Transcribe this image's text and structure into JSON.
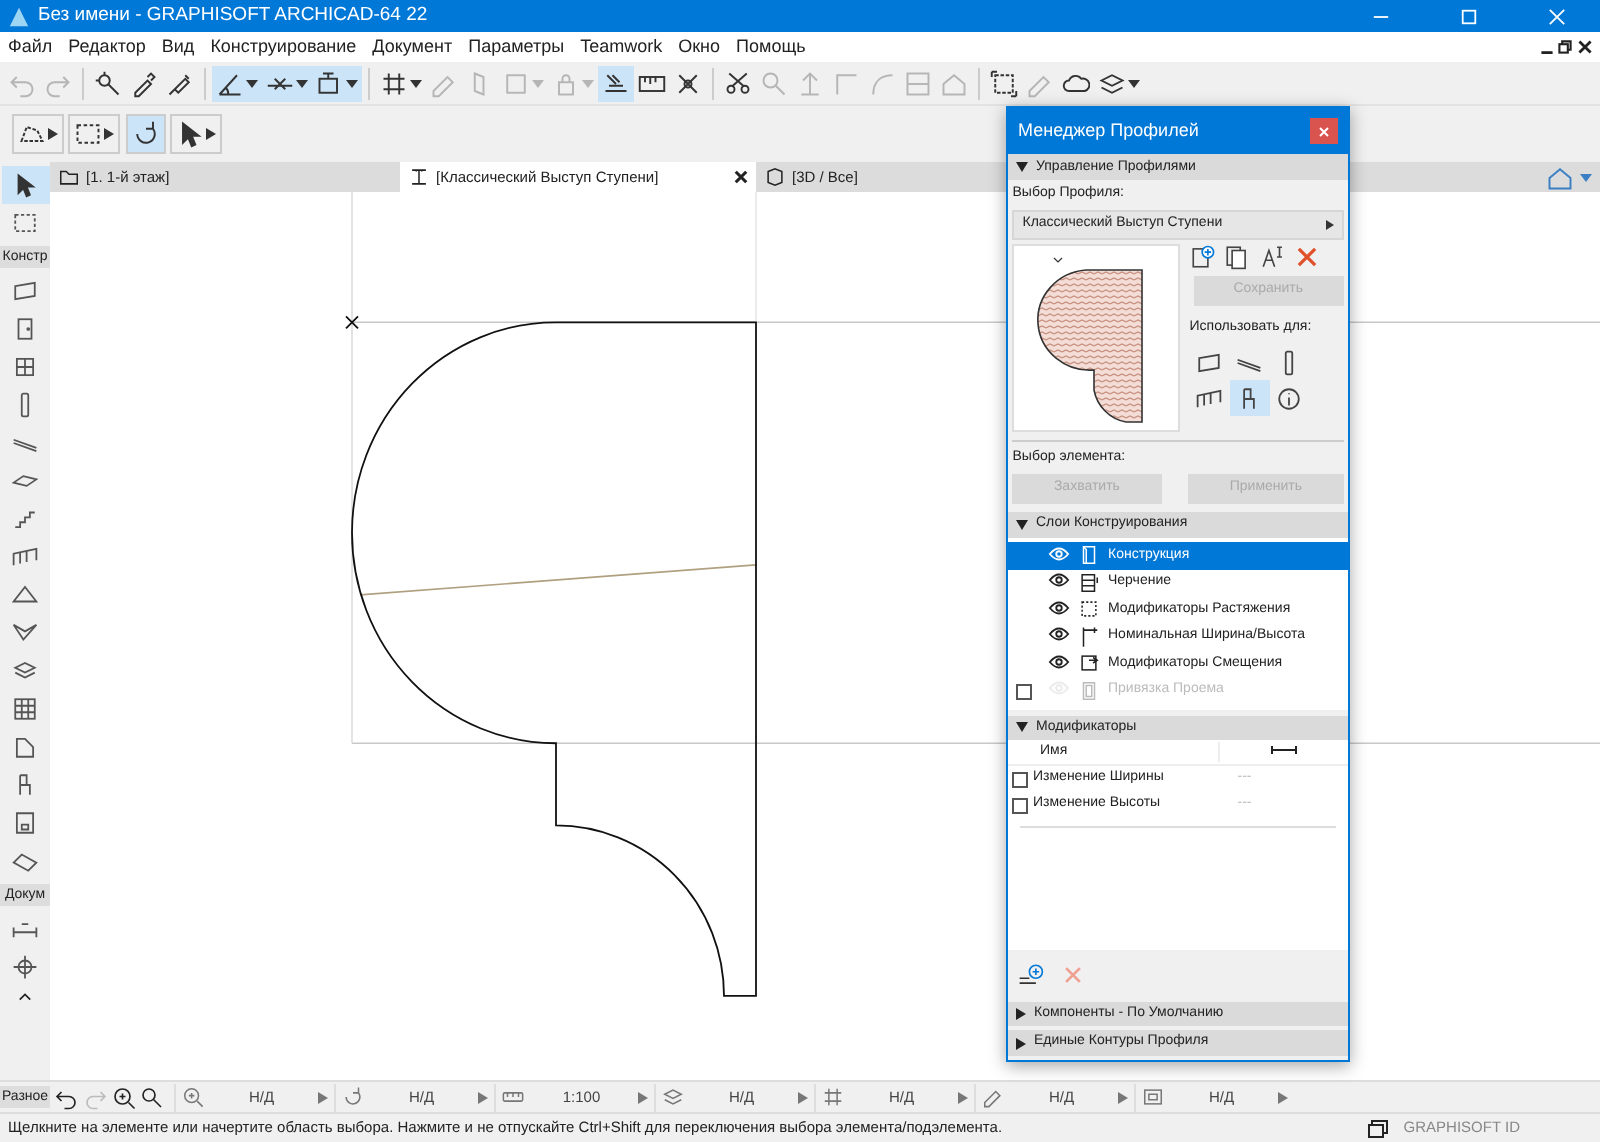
{
  "window": {
    "title": "Без имени - GRAPHISOFT ARCHICAD-64 22"
  },
  "menu": [
    "Файл",
    "Редактор",
    "Вид",
    "Конструирование",
    "Документ",
    "Параметры",
    "Teamwork",
    "Окно",
    "Помощь"
  ],
  "toolbar": [
    [
      {
        "kind": "undo",
        "on": false,
        "disabled": true,
        "dropdown": false
      },
      {
        "kind": "redo",
        "on": false,
        "disabled": true,
        "dropdown": false
      }
    ],
    [
      {
        "kind": "wand",
        "on": false,
        "disabled": false,
        "dropdown": false
      },
      {
        "kind": "eyedropper",
        "on": false,
        "disabled": false,
        "dropdown": false
      },
      {
        "kind": "syringe",
        "on": false,
        "disabled": false,
        "dropdown": false
      }
    ],
    [
      {
        "kind": "angle",
        "on": true,
        "disabled": false,
        "dropdown": true
      },
      {
        "kind": "snapline",
        "on": true,
        "disabled": false,
        "dropdown": true
      },
      {
        "kind": "boxsnap",
        "on": true,
        "disabled": false,
        "dropdown": true
      }
    ],
    [
      {
        "kind": "grid",
        "on": false,
        "disabled": false,
        "dropdown": true
      },
      {
        "kind": "pen",
        "on": false,
        "disabled": true,
        "dropdown": false
      },
      {
        "kind": "skew",
        "on": false,
        "disabled": true,
        "dropdown": false
      },
      {
        "kind": "square",
        "on": false,
        "disabled": true,
        "dropdown": true
      },
      {
        "kind": "lock",
        "on": false,
        "disabled": true,
        "dropdown": true
      },
      {
        "kind": "cursorgrid",
        "on": true,
        "disabled": false,
        "dropdown": false
      },
      {
        "kind": "ruler",
        "on": false,
        "disabled": false,
        "dropdown": false
      },
      {
        "kind": "cross",
        "on": false,
        "disabled": false,
        "dropdown": false
      }
    ],
    [
      {
        "kind": "scissors",
        "on": false,
        "disabled": false,
        "dropdown": false
      },
      {
        "kind": "magnifier",
        "on": false,
        "disabled": true,
        "dropdown": false
      },
      {
        "kind": "up",
        "on": false,
        "disabled": true,
        "dropdown": false
      },
      {
        "kind": "corner",
        "on": false,
        "disabled": true,
        "dropdown": false
      },
      {
        "kind": "curve",
        "on": false,
        "disabled": true,
        "dropdown": false
      },
      {
        "kind": "split",
        "on": false,
        "disabled": true,
        "dropdown": false
      },
      {
        "kind": "house",
        "on": false,
        "disabled": true,
        "dropdown": false
      }
    ],
    [
      {
        "kind": "selectframe",
        "on": false,
        "disabled": false,
        "dropdown": false
      },
      {
        "kind": "pen",
        "on": false,
        "disabled": true,
        "dropdown": false
      },
      {
        "kind": "cloud",
        "on": false,
        "disabled": false,
        "dropdown": false
      },
      {
        "kind": "layers",
        "on": false,
        "disabled": false,
        "dropdown": true
      }
    ]
  ],
  "toolbar_2": [
    {
      "kind": "polypick",
      "on": false,
      "dropdown": true
    },
    {
      "kind": "marquee",
      "on": false,
      "dropdown": true
    },
    {
      "kind": "rotate",
      "on": true,
      "dropdown": false
    },
    {
      "kind": "arrow",
      "on": false,
      "dropdown": true
    }
  ],
  "tabs": [
    {
      "label": "[1. 1-й этаж]",
      "kind": "floor",
      "selected": false
    },
    {
      "label": "[Классический Выступ Ступени]",
      "kind": "profile",
      "selected": true
    },
    {
      "label": "[3D / Все]",
      "kind": "cube",
      "selected": false
    }
  ],
  "toolbox": {
    "tools": [
      {
        "kind": "arrow",
        "selected": true
      },
      {
        "kind": "marquee",
        "selected": false
      }
    ],
    "sections": [
      {
        "label": "Констр",
        "tools": [
          {
            "kind": "wall",
            "selected": false
          },
          {
            "kind": "door",
            "selected": false
          },
          {
            "kind": "window",
            "selected": false
          },
          {
            "kind": "column",
            "selected": false
          },
          {
            "kind": "beam",
            "selected": false
          },
          {
            "kind": "slab",
            "selected": false
          },
          {
            "kind": "stair",
            "selected": false
          },
          {
            "kind": "railing",
            "selected": false
          },
          {
            "kind": "roof",
            "selected": false
          },
          {
            "kind": "shell",
            "selected": false
          },
          {
            "kind": "morph",
            "selected": false
          },
          {
            "kind": "curtainwall",
            "selected": false
          },
          {
            "kind": "zone",
            "selected": false
          },
          {
            "kind": "object",
            "selected": false
          },
          {
            "kind": "lamp",
            "selected": false
          },
          {
            "kind": "mesh",
            "selected": false
          }
        ]
      },
      {
        "label": "Докум",
        "tools": [
          {
            "kind": "dimension",
            "selected": false
          },
          {
            "kind": "level",
            "selected": false
          }
        ]
      }
    ],
    "footer_label": "Разное"
  },
  "profile_manager": {
    "title": "Менеджер Профилей",
    "profile_section": {
      "title": "Управление Профилями",
      "expanded": true,
      "choose_label": "Выбор Профиля:",
      "profile": "Классический Выступ Ступени",
      "save": {
        "label": "Сохранить",
        "disabled": true
      },
      "use_for_label": "Использовать для:",
      "use_for": [
        {
          "kind": "wall",
          "selected": false
        },
        {
          "kind": "beam",
          "selected": false
        },
        {
          "kind": "column",
          "selected": false
        },
        {
          "kind": "railing",
          "selected": false
        },
        {
          "kind": "object",
          "selected": true
        },
        {
          "kind": "info",
          "selected": false
        }
      ],
      "element_label": "Выбор элемента:",
      "element_buttons": [
        {
          "label": "Захватить",
          "disabled": true
        },
        {
          "label": "Применить",
          "disabled": true
        }
      ]
    },
    "layers_section": {
      "title": "Слои Конструирования",
      "expanded": true,
      "layers": [
        {
          "name": "Конструкция",
          "kind": "construction",
          "visible": true,
          "selected": true,
          "enabled": true
        },
        {
          "name": "Черчение",
          "kind": "drafting",
          "visible": true,
          "selected": false,
          "enabled": true
        },
        {
          "name": "Модификаторы Растяжения",
          "kind": "stretch",
          "visible": true,
          "selected": false,
          "enabled": true
        },
        {
          "name": "Номинальная Ширина/Высота",
          "kind": "nominal",
          "visible": true,
          "selected": false,
          "enabled": true
        },
        {
          "name": "Модификаторы Смещения",
          "kind": "offset",
          "visible": true,
          "selected": false,
          "enabled": true
        },
        {
          "name": "Привязка Проема",
          "kind": "opening",
          "visible": false,
          "selected": false,
          "enabled": false,
          "checked": false
        }
      ]
    },
    "modifiers_section": {
      "title": "Модификаторы",
      "expanded": true,
      "name_column": "Имя",
      "rows": [
        {
          "name": "Изменение Ширины",
          "checked": false,
          "value": "---"
        },
        {
          "name": "Изменение Высоты",
          "checked": false,
          "value": "---"
        }
      ]
    },
    "more_sections": [
      {
        "title": "Компоненты - По Умолчанию",
        "expanded": false
      },
      {
        "title": "Единые Контуры Профиля",
        "expanded": false
      }
    ]
  },
  "view_fields": [
    {
      "kind": "zoomfit",
      "value": "Н/Д"
    },
    {
      "kind": "rotate",
      "value": "Н/Д"
    },
    {
      "kind": "scale",
      "value": "1:100"
    },
    {
      "kind": "layers",
      "value": "Н/Д"
    },
    {
      "kind": "grid",
      "value": "Н/Д"
    },
    {
      "kind": "pen",
      "value": "Н/Д"
    },
    {
      "kind": "model",
      "value": "Н/Д"
    }
  ],
  "status_bar": {
    "text": "Щелкните на элементе или начертите область выбора. Нажмите и не отпускайте Ctrl+Shift для переключения выбора элемента/подэлемента.",
    "account": "GRAPHISOFT ID"
  }
}
